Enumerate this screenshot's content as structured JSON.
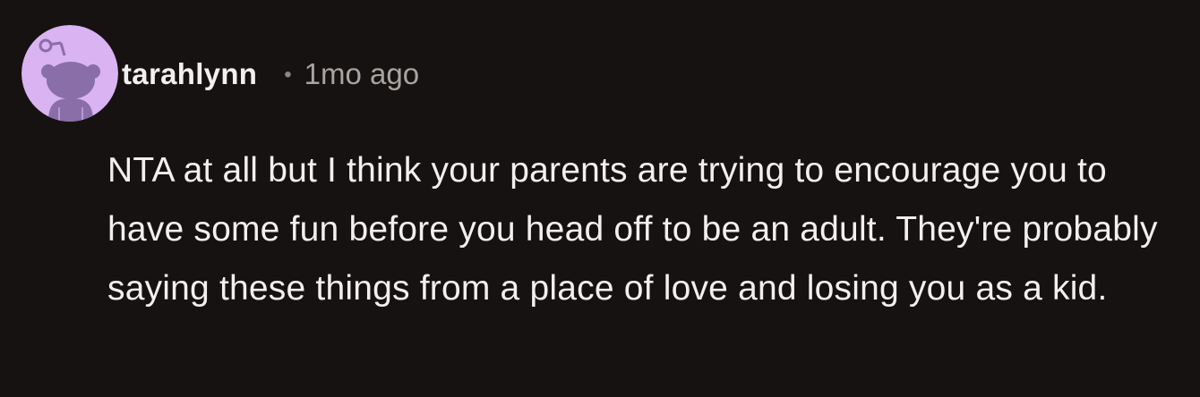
{
  "comment": {
    "author": "tarahlynn",
    "separator": "•",
    "timestamp": "1mo ago",
    "body": "NTA at all but I think your parents are trying to encourage you to have some fun before you head off to be an adult. They're probably saying these things from a place of love and losing you as a kid."
  },
  "avatar": {
    "icon": "snoo-avatar-icon",
    "background_color": "#d9b3f2",
    "figure_color": "#8a6ea8"
  },
  "colors": {
    "background": "#151211",
    "text_primary": "#f2f0ef",
    "text_secondary": "#a9a4a1"
  }
}
